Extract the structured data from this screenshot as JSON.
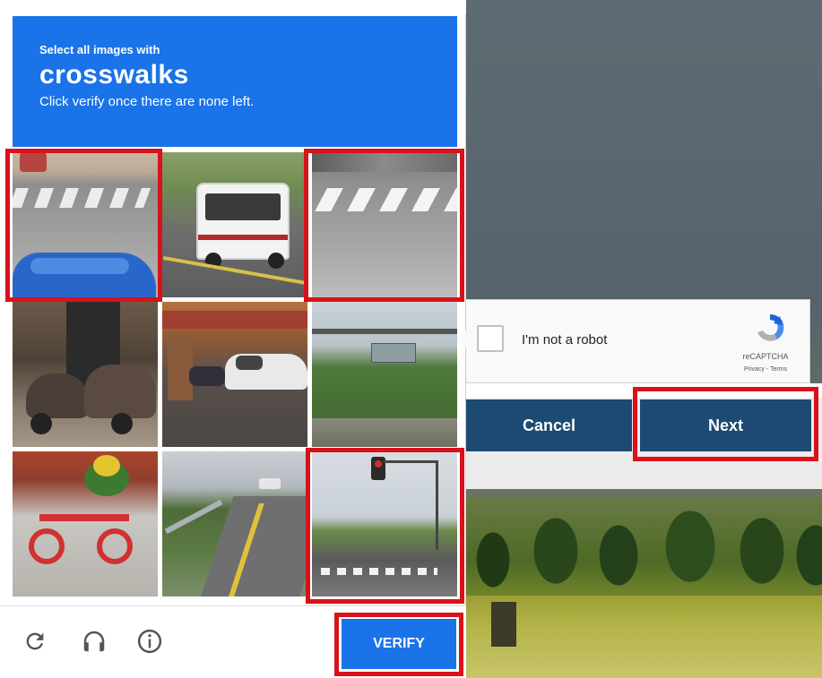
{
  "challenge": {
    "instruction_small": "Select all images with",
    "target_object": "crosswalks",
    "instruction_sub": "Click verify once there are none left."
  },
  "tiles": [
    {
      "scene": "street-crosswalk-blue-tarp",
      "selected": true
    },
    {
      "scene": "white-shuttle-bus",
      "selected": false
    },
    {
      "scene": "crosswalk-asphalt",
      "selected": true
    },
    {
      "scene": "motorcycles-storefront",
      "selected": false
    },
    {
      "scene": "parked-scooters-car",
      "selected": false
    },
    {
      "scene": "highway-sign-trees",
      "selected": false
    },
    {
      "scene": "red-tricycle",
      "selected": false
    },
    {
      "scene": "curved-road-guardrail",
      "selected": false
    },
    {
      "scene": "traffic-light-intersection",
      "selected": true
    }
  ],
  "footer": {
    "reload_icon": "reload-icon",
    "audio_icon": "headphones-icon",
    "info_icon": "info-icon",
    "verify_label": "VERIFY"
  },
  "recaptcha": {
    "checkbox_label": "I'm not a robot",
    "brand": "reCAPTCHA",
    "terms": "Privacy - Terms"
  },
  "dialog": {
    "cancel_label": "Cancel",
    "next_label": "Next"
  },
  "colors": {
    "accent_blue": "#1a73e8",
    "highlight_red": "#d8111a",
    "dialog_button": "#1c4a72"
  }
}
